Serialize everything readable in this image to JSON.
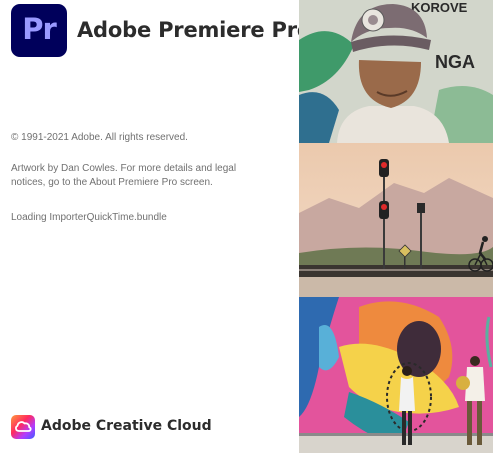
{
  "app": {
    "logo_text": "Pr",
    "product_name": "Adobe Premiere Pro",
    "copyright": "© 1991-2021 Adobe. All rights reserved.",
    "artwork_credit": "Artwork by Dan Cowles. For more details and legal notices, go to the About Premiere Pro screen.",
    "loading_status": "Loading ImporterQuickTime.bundle"
  },
  "footer": {
    "brand": "Adobe Creative Cloud",
    "icon": "creative-cloud-icon"
  },
  "artwork": {
    "mural_text_top": "KOROVE",
    "mural_text_mid": "NGA",
    "colors": {
      "brand_bg": "#00005b",
      "brand_letters": "#9999ff",
      "mural_pink": "#e3549c",
      "sky_top": "#ebc9ad"
    }
  }
}
